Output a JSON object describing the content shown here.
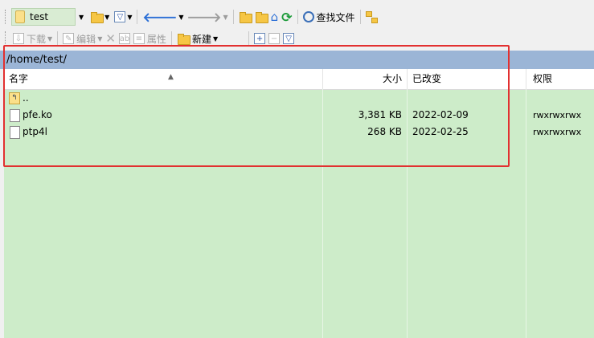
{
  "toolbar1": {
    "drive_name": "test",
    "find_files_label": "查找文件"
  },
  "toolbar2": {
    "download_label": "下载",
    "edit_label": "编辑",
    "properties_label": "属性",
    "new_label": "新建"
  },
  "path": "/home/test/",
  "columns": {
    "name": "名字",
    "size": "大小",
    "modified": "已改变",
    "permissions": "权限"
  },
  "files": [
    {
      "name": "..",
      "size": "",
      "modified": "",
      "permissions": "",
      "icon": "parent-folder-icon"
    },
    {
      "name": "pfe.ko",
      "size": "3,381 KB",
      "modified": "2022-02-09",
      "permissions": "rwxrwxrwx",
      "icon": "file-icon"
    },
    {
      "name": "ptp4l",
      "size": "268 KB",
      "modified": "2022-02-25",
      "permissions": "rwxrwxrwx",
      "icon": "file-icon"
    }
  ],
  "colors": {
    "panel_bg": "#cdecc9",
    "path_bar": "#9bb5d6",
    "highlight_border": "#e23030"
  }
}
